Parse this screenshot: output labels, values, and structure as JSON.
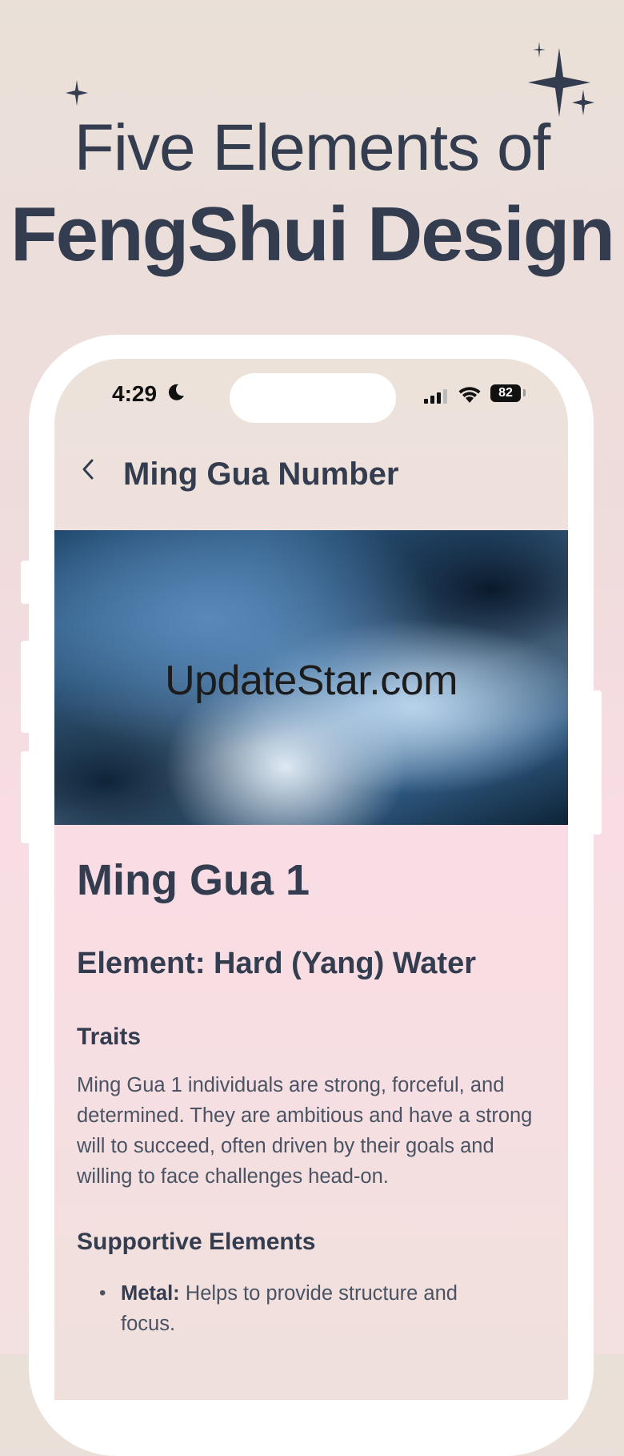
{
  "headline": {
    "line1": "Five Elements of",
    "line2": "FengShui Design"
  },
  "status_bar": {
    "time": "4:29",
    "battery": "82"
  },
  "nav": {
    "title": "Ming Gua Number"
  },
  "hero": {
    "watermark": "UpdateStar.com"
  },
  "content": {
    "title": "Ming Gua 1",
    "element": "Element: Hard (Yang) Water",
    "traits_heading": "Traits",
    "traits_body": "Ming Gua 1 individuals are strong, forceful, and determined. They are ambitious and have a strong will to succeed, often driven by their goals and willing to face challenges head-on.",
    "supportive_heading": "Supportive Elements",
    "supportive_items": [
      {
        "name": "Metal:",
        "text": "Helps to provide structure and focus."
      }
    ]
  },
  "colors": {
    "text_dark": "#333d4f",
    "body_text": "#4a5363",
    "phone_frame": "#ffffff"
  },
  "icons": [
    "sparkle-icon",
    "moon-icon",
    "signal-icon",
    "wifi-icon",
    "battery-icon",
    "back-chevron-icon"
  ]
}
